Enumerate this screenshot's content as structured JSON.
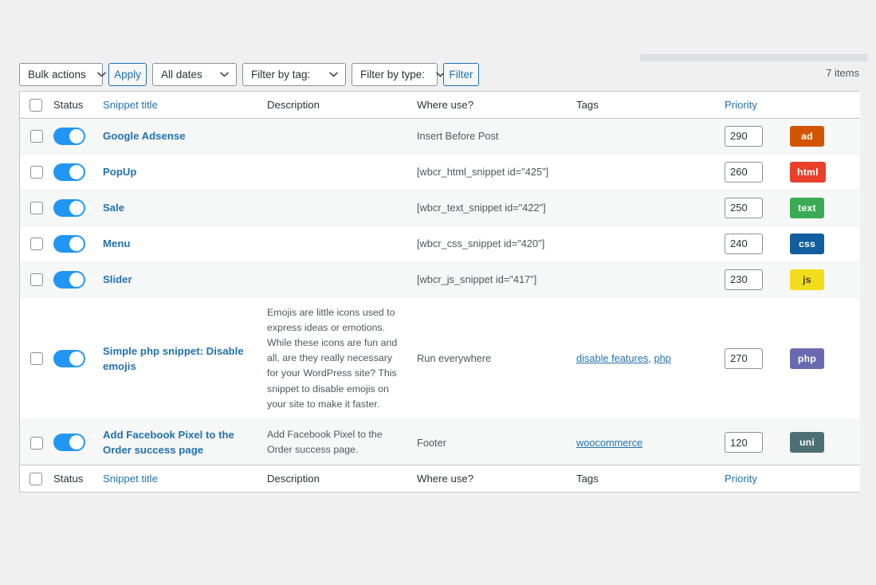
{
  "toolbar": {
    "bulk_actions_label": "Bulk actions",
    "apply_label": "Apply",
    "all_dates_label": "All dates",
    "filter_by_tag_label": "Filter by tag:",
    "filter_by_type_label": "Filter by type:",
    "filter_label": "Filter"
  },
  "items_count": "7 items",
  "columns": {
    "status": "Status",
    "snippet_title": "Snippet title",
    "description": "Description",
    "where_use": "Where use?",
    "tags": "Tags",
    "priority": "Priority"
  },
  "rows": [
    {
      "title": "Google Adsense",
      "description": "",
      "where_use": "Insert Before Post",
      "tags": [],
      "priority": "290",
      "type": "ad",
      "type_color": "#d35400",
      "type_text_color": "#ffffff",
      "enabled": true
    },
    {
      "title": "PopUp",
      "description": "",
      "where_use": "[wbcr_html_snippet id=\"425\"]",
      "tags": [],
      "priority": "260",
      "type": "html",
      "type_color": "#e8402a",
      "type_text_color": "#ffffff",
      "enabled": true
    },
    {
      "title": "Sale",
      "description": "",
      "where_use": "[wbcr_text_snippet id=\"422\"]",
      "tags": [],
      "priority": "250",
      "type": "text",
      "type_color": "#3aab54",
      "type_text_color": "#ffffff",
      "enabled": true
    },
    {
      "title": "Menu",
      "description": "",
      "where_use": "[wbcr_css_snippet id=\"420\"]",
      "tags": [],
      "priority": "240",
      "type": "css",
      "type_color": "#125e9e",
      "type_text_color": "#ffffff",
      "enabled": true
    },
    {
      "title": "Slider",
      "description": "",
      "where_use": "[wbcr_js_snippet id=\"417\"]",
      "tags": [],
      "priority": "230",
      "type": "js",
      "type_color": "#f2dd1c",
      "type_text_color": "#3c3c1a",
      "enabled": true
    },
    {
      "title": "Simple php snippet: Disable emojis",
      "description": "Emojis are little icons used to express ideas or emotions. While these icons are fun and all, are they really necessary for your WordPress site? This snippet to disable emojis on your site to make it faster.",
      "where_use": "Run everywhere",
      "tags": [
        "disable features",
        "php"
      ],
      "priority": "270",
      "type": "php",
      "type_color": "#6a6ab0",
      "type_text_color": "#ffffff",
      "enabled": true
    },
    {
      "title": "Add Facebook Pixel to the Order success page",
      "description": "Add Facebook Pixel to the Order success page.",
      "where_use": "Footer",
      "tags": [
        "woocommerce"
      ],
      "priority": "120",
      "type": "uni",
      "type_color": "#4d6e73",
      "type_text_color": "#ffffff",
      "enabled": true
    }
  ]
}
